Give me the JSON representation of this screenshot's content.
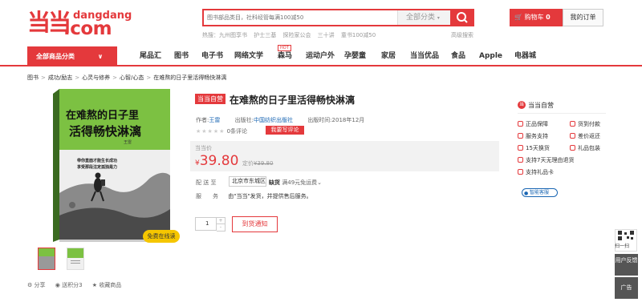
{
  "header": {
    "logo_cn": "当当",
    "logo_en1": "dangdang",
    "logo_en2": ".com",
    "search_placeholder": "图书部品类目，社科经管每满100减50",
    "search_category": "全部分类",
    "hot_words": "热搜：九州图享书 护士三基 探险家公会 三十讲 童书100减50",
    "advanced_search": "高级搜索",
    "cart_label": "购物车",
    "cart_count": "0",
    "orders_label": "我的订单"
  },
  "nav": {
    "all_categories": "全部商品分类",
    "items": [
      "尾品汇",
      "图书",
      "电子书",
      "网络文学",
      "森马",
      "运动户外",
      "孕婴童",
      "家居",
      "当当优品",
      "食品",
      "Apple",
      "电器城"
    ],
    "hot_badge": "HOT"
  },
  "breadcrumb": [
    "图书",
    ">",
    "成功/励志",
    ">",
    "心灵与修养",
    ">",
    "心智/心态",
    ">",
    "在难熬的日子里活得畅快淋漓"
  ],
  "book_cover": {
    "title_line1": "在难熬的日子里",
    "title_line2": "活得畅快淋漓",
    "author": "王雷",
    "subtitle_line1": "带你直面才能生长成功",
    "subtitle_line2": "享受那段注定孤独是力"
  },
  "free_read": "免费在线读",
  "share_bar": {
    "share": "分享",
    "points": "送积分3",
    "fav": "收藏商品"
  },
  "product": {
    "self_tag": "当当自营",
    "title": "在难熬的日子里活得畅快淋漓",
    "author_label": "作者:",
    "author": "王雷",
    "publisher_label": "出版社:",
    "publisher": "中国纺织出版社",
    "pubdate_label": "出版时间:",
    "pubdate": "2018年12月",
    "stars": "★★★★★",
    "review_count": "0条评论",
    "write_review": "我要写评论",
    "price_label": "当当价",
    "currency": "¥",
    "price": "39.80",
    "orig_label": "定价",
    "orig_price": "¥39.80",
    "ship_label": "配 送 至",
    "ship_addr": "北京市东城区",
    "stock_status": "缺货",
    "free_ship": "满49元免运费",
    "service_label": "服　　务",
    "service_text": "由\"当当\"发货，并提供售后服务。",
    "qty": "1",
    "notify_btn": "到货通知"
  },
  "shop": {
    "name": "当当自营",
    "features": [
      "正品保障",
      "货到付款",
      "服务支持",
      "差价返还",
      "15天换货",
      "礼品包装",
      "支持7天无理由退货",
      "支持礼品卡"
    ],
    "customer_service": "智能客服"
  },
  "right_float": {
    "qr_label": "扫一扫",
    "feedback": "用户反馈",
    "ad": "广告"
  },
  "colors": {
    "brand": "#e4393c",
    "link": "#1a66b3",
    "badge": "#f5c600"
  }
}
